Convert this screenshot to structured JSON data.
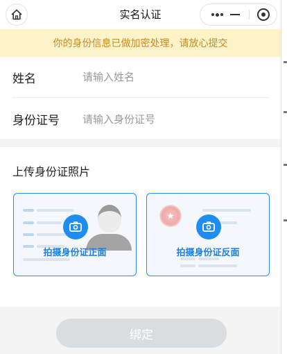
{
  "navbar": {
    "title": "实名认证",
    "home_icon": "home-icon",
    "more_icon": "more-dots-icon",
    "minimize_icon": "minimize-icon",
    "close_icon": "close-circle-icon"
  },
  "notice": {
    "text": "你的身份信息已做加密处理，请放心提交",
    "bg_color": "#fdf3c9",
    "text_color": "#cc8a1e"
  },
  "form": {
    "name": {
      "label": "姓名",
      "placeholder": "请输入姓名",
      "value": ""
    },
    "id_number": {
      "label": "身份证号",
      "placeholder": "请输入身份证号",
      "value": ""
    }
  },
  "upload": {
    "title": "上传身份证照片",
    "front": {
      "caption": "拍摄身份证正面",
      "icon": "camera-icon"
    },
    "back": {
      "caption": "拍摄身份证反面",
      "icon": "camera-icon"
    },
    "accent_color": "#1f8cf0"
  },
  "submit": {
    "label": "绑定",
    "disabled": true
  }
}
